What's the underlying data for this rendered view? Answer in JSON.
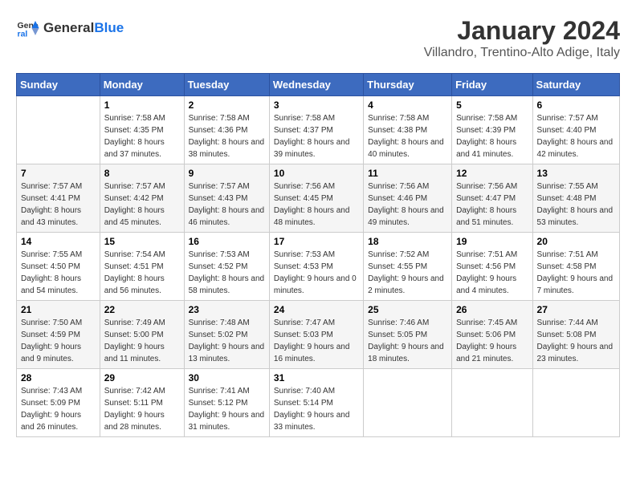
{
  "logo": {
    "general": "General",
    "blue": "Blue"
  },
  "header": {
    "month_year": "January 2024",
    "location": "Villandro, Trentino-Alto Adige, Italy"
  },
  "days_of_week": [
    "Sunday",
    "Monday",
    "Tuesday",
    "Wednesday",
    "Thursday",
    "Friday",
    "Saturday"
  ],
  "weeks": [
    [
      {
        "day": "",
        "sunrise": "",
        "sunset": "",
        "daylight": ""
      },
      {
        "day": "1",
        "sunrise": "Sunrise: 7:58 AM",
        "sunset": "Sunset: 4:35 PM",
        "daylight": "Daylight: 8 hours and 37 minutes."
      },
      {
        "day": "2",
        "sunrise": "Sunrise: 7:58 AM",
        "sunset": "Sunset: 4:36 PM",
        "daylight": "Daylight: 8 hours and 38 minutes."
      },
      {
        "day": "3",
        "sunrise": "Sunrise: 7:58 AM",
        "sunset": "Sunset: 4:37 PM",
        "daylight": "Daylight: 8 hours and 39 minutes."
      },
      {
        "day": "4",
        "sunrise": "Sunrise: 7:58 AM",
        "sunset": "Sunset: 4:38 PM",
        "daylight": "Daylight: 8 hours and 40 minutes."
      },
      {
        "day": "5",
        "sunrise": "Sunrise: 7:58 AM",
        "sunset": "Sunset: 4:39 PM",
        "daylight": "Daylight: 8 hours and 41 minutes."
      },
      {
        "day": "6",
        "sunrise": "Sunrise: 7:57 AM",
        "sunset": "Sunset: 4:40 PM",
        "daylight": "Daylight: 8 hours and 42 minutes."
      }
    ],
    [
      {
        "day": "7",
        "sunrise": "Sunrise: 7:57 AM",
        "sunset": "Sunset: 4:41 PM",
        "daylight": "Daylight: 8 hours and 43 minutes."
      },
      {
        "day": "8",
        "sunrise": "Sunrise: 7:57 AM",
        "sunset": "Sunset: 4:42 PM",
        "daylight": "Daylight: 8 hours and 45 minutes."
      },
      {
        "day": "9",
        "sunrise": "Sunrise: 7:57 AM",
        "sunset": "Sunset: 4:43 PM",
        "daylight": "Daylight: 8 hours and 46 minutes."
      },
      {
        "day": "10",
        "sunrise": "Sunrise: 7:56 AM",
        "sunset": "Sunset: 4:45 PM",
        "daylight": "Daylight: 8 hours and 48 minutes."
      },
      {
        "day": "11",
        "sunrise": "Sunrise: 7:56 AM",
        "sunset": "Sunset: 4:46 PM",
        "daylight": "Daylight: 8 hours and 49 minutes."
      },
      {
        "day": "12",
        "sunrise": "Sunrise: 7:56 AM",
        "sunset": "Sunset: 4:47 PM",
        "daylight": "Daylight: 8 hours and 51 minutes."
      },
      {
        "day": "13",
        "sunrise": "Sunrise: 7:55 AM",
        "sunset": "Sunset: 4:48 PM",
        "daylight": "Daylight: 8 hours and 53 minutes."
      }
    ],
    [
      {
        "day": "14",
        "sunrise": "Sunrise: 7:55 AM",
        "sunset": "Sunset: 4:50 PM",
        "daylight": "Daylight: 8 hours and 54 minutes."
      },
      {
        "day": "15",
        "sunrise": "Sunrise: 7:54 AM",
        "sunset": "Sunset: 4:51 PM",
        "daylight": "Daylight: 8 hours and 56 minutes."
      },
      {
        "day": "16",
        "sunrise": "Sunrise: 7:53 AM",
        "sunset": "Sunset: 4:52 PM",
        "daylight": "Daylight: 8 hours and 58 minutes."
      },
      {
        "day": "17",
        "sunrise": "Sunrise: 7:53 AM",
        "sunset": "Sunset: 4:53 PM",
        "daylight": "Daylight: 9 hours and 0 minutes."
      },
      {
        "day": "18",
        "sunrise": "Sunrise: 7:52 AM",
        "sunset": "Sunset: 4:55 PM",
        "daylight": "Daylight: 9 hours and 2 minutes."
      },
      {
        "day": "19",
        "sunrise": "Sunrise: 7:51 AM",
        "sunset": "Sunset: 4:56 PM",
        "daylight": "Daylight: 9 hours and 4 minutes."
      },
      {
        "day": "20",
        "sunrise": "Sunrise: 7:51 AM",
        "sunset": "Sunset: 4:58 PM",
        "daylight": "Daylight: 9 hours and 7 minutes."
      }
    ],
    [
      {
        "day": "21",
        "sunrise": "Sunrise: 7:50 AM",
        "sunset": "Sunset: 4:59 PM",
        "daylight": "Daylight: 9 hours and 9 minutes."
      },
      {
        "day": "22",
        "sunrise": "Sunrise: 7:49 AM",
        "sunset": "Sunset: 5:00 PM",
        "daylight": "Daylight: 9 hours and 11 minutes."
      },
      {
        "day": "23",
        "sunrise": "Sunrise: 7:48 AM",
        "sunset": "Sunset: 5:02 PM",
        "daylight": "Daylight: 9 hours and 13 minutes."
      },
      {
        "day": "24",
        "sunrise": "Sunrise: 7:47 AM",
        "sunset": "Sunset: 5:03 PM",
        "daylight": "Daylight: 9 hours and 16 minutes."
      },
      {
        "day": "25",
        "sunrise": "Sunrise: 7:46 AM",
        "sunset": "Sunset: 5:05 PM",
        "daylight": "Daylight: 9 hours and 18 minutes."
      },
      {
        "day": "26",
        "sunrise": "Sunrise: 7:45 AM",
        "sunset": "Sunset: 5:06 PM",
        "daylight": "Daylight: 9 hours and 21 minutes."
      },
      {
        "day": "27",
        "sunrise": "Sunrise: 7:44 AM",
        "sunset": "Sunset: 5:08 PM",
        "daylight": "Daylight: 9 hours and 23 minutes."
      }
    ],
    [
      {
        "day": "28",
        "sunrise": "Sunrise: 7:43 AM",
        "sunset": "Sunset: 5:09 PM",
        "daylight": "Daylight: 9 hours and 26 minutes."
      },
      {
        "day": "29",
        "sunrise": "Sunrise: 7:42 AM",
        "sunset": "Sunset: 5:11 PM",
        "daylight": "Daylight: 9 hours and 28 minutes."
      },
      {
        "day": "30",
        "sunrise": "Sunrise: 7:41 AM",
        "sunset": "Sunset: 5:12 PM",
        "daylight": "Daylight: 9 hours and 31 minutes."
      },
      {
        "day": "31",
        "sunrise": "Sunrise: 7:40 AM",
        "sunset": "Sunset: 5:14 PM",
        "daylight": "Daylight: 9 hours and 33 minutes."
      },
      {
        "day": "",
        "sunrise": "",
        "sunset": "",
        "daylight": ""
      },
      {
        "day": "",
        "sunrise": "",
        "sunset": "",
        "daylight": ""
      },
      {
        "day": "",
        "sunrise": "",
        "sunset": "",
        "daylight": ""
      }
    ]
  ]
}
